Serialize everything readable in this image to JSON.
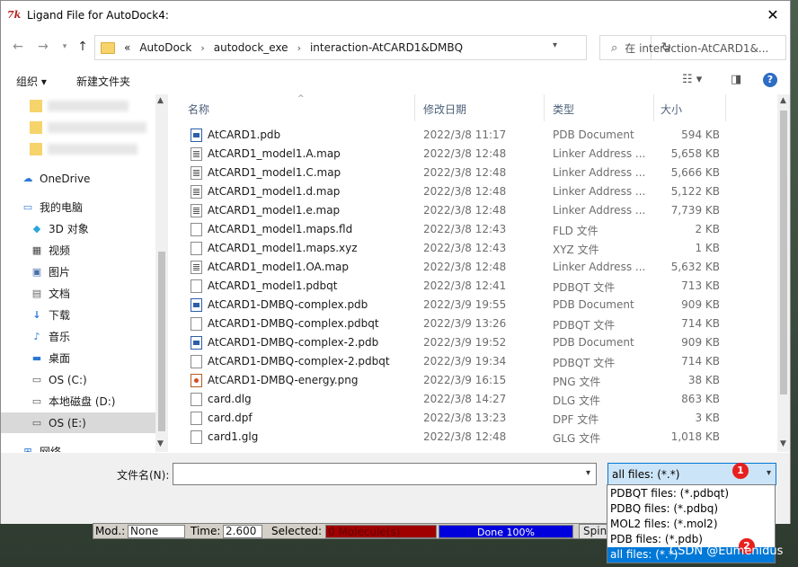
{
  "window": {
    "title": "Ligand File for AutoDock4:",
    "app_icon": "7k"
  },
  "addressbar": {
    "overflow": "«",
    "breadcrumbs": [
      "AutoDock",
      "autodock_exe",
      "interaction-AtCARD1&DMBQ"
    ],
    "search_placeholder": "在 interaction-AtCARD1&..."
  },
  "toolbar": {
    "organize": "组织 ▾",
    "new_folder": "新建文件夹"
  },
  "sidebar": {
    "items": [
      {
        "label": "OneDrive",
        "icon": "cloud-icon"
      },
      {
        "label": "我的电脑",
        "icon": "computer-icon"
      },
      {
        "label": "3D 对象",
        "icon": "3d-objects-icon"
      },
      {
        "label": "视频",
        "icon": "video-icon"
      },
      {
        "label": "图片",
        "icon": "pictures-icon"
      },
      {
        "label": "文档",
        "icon": "documents-icon"
      },
      {
        "label": "下载",
        "icon": "download-icon"
      },
      {
        "label": "音乐",
        "icon": "music-icon"
      },
      {
        "label": "桌面",
        "icon": "desktop-icon"
      },
      {
        "label": "OS (C:)",
        "icon": "drive-icon"
      },
      {
        "label": "本地磁盘 (D:)",
        "icon": "drive-icon"
      },
      {
        "label": "OS (E:)",
        "icon": "drive-icon"
      },
      {
        "label": "网络",
        "icon": "network-icon"
      }
    ]
  },
  "columns": {
    "name": "名称",
    "date": "修改日期",
    "type": "类型",
    "size": "大小"
  },
  "files": [
    {
      "name": "AtCARD1.pdb",
      "date": "2022/3/8 11:17",
      "type": "PDB Document",
      "size": "594 KB",
      "icon": "pdb"
    },
    {
      "name": "AtCARD1_model1.A.map",
      "date": "2022/3/8 12:48",
      "type": "Linker Address ...",
      "size": "5,658 KB",
      "icon": "map"
    },
    {
      "name": "AtCARD1_model1.C.map",
      "date": "2022/3/8 12:48",
      "type": "Linker Address ...",
      "size": "5,666 KB",
      "icon": "map"
    },
    {
      "name": "AtCARD1_model1.d.map",
      "date": "2022/3/8 12:48",
      "type": "Linker Address ...",
      "size": "5,122 KB",
      "icon": "map"
    },
    {
      "name": "AtCARD1_model1.e.map",
      "date": "2022/3/8 12:48",
      "type": "Linker Address ...",
      "size": "7,739 KB",
      "icon": "map"
    },
    {
      "name": "AtCARD1_model1.maps.fld",
      "date": "2022/3/8 12:43",
      "type": "FLD 文件",
      "size": "2 KB",
      "icon": "file"
    },
    {
      "name": "AtCARD1_model1.maps.xyz",
      "date": "2022/3/8 12:43",
      "type": "XYZ 文件",
      "size": "1 KB",
      "icon": "file"
    },
    {
      "name": "AtCARD1_model1.OA.map",
      "date": "2022/3/8 12:48",
      "type": "Linker Address ...",
      "size": "5,632 KB",
      "icon": "map"
    },
    {
      "name": "AtCARD1_model1.pdbqt",
      "date": "2022/3/8 12:41",
      "type": "PDBQT 文件",
      "size": "713 KB",
      "icon": "file"
    },
    {
      "name": "AtCARD1-DMBQ-complex.pdb",
      "date": "2022/3/9 19:55",
      "type": "PDB Document",
      "size": "909 KB",
      "icon": "pdb"
    },
    {
      "name": "AtCARD1-DMBQ-complex.pdbqt",
      "date": "2022/3/9 13:26",
      "type": "PDBQT 文件",
      "size": "714 KB",
      "icon": "file"
    },
    {
      "name": "AtCARD1-DMBQ-complex-2.pdb",
      "date": "2022/3/9 19:52",
      "type": "PDB Document",
      "size": "909 KB",
      "icon": "pdb"
    },
    {
      "name": "AtCARD1-DMBQ-complex-2.pdbqt",
      "date": "2022/3/9 19:34",
      "type": "PDBQT 文件",
      "size": "714 KB",
      "icon": "file"
    },
    {
      "name": "AtCARD1-DMBQ-energy.png",
      "date": "2022/3/9 16:15",
      "type": "PNG 文件",
      "size": "38 KB",
      "icon": "png"
    },
    {
      "name": "card.dlg",
      "date": "2022/3/8 14:27",
      "type": "DLG 文件",
      "size": "863 KB",
      "icon": "file"
    },
    {
      "name": "card.dpf",
      "date": "2022/3/8 13:23",
      "type": "DPF 文件",
      "size": "3 KB",
      "icon": "file"
    },
    {
      "name": "card1.glg",
      "date": "2022/3/8 12:48",
      "type": "GLG 文件",
      "size": "1,018 KB",
      "icon": "file"
    }
  ],
  "bottom": {
    "filename_label": "文件名(N):",
    "filename_value": "",
    "filetype_selected": "all files: (*.*)",
    "filetype_options": [
      "PDBQT files: (*.pdbqt)",
      "PDBQ files: (*.pdbq)",
      "MOL2 files: (*.mol2)",
      "PDB files: (*.pdb)",
      "all files: (*.*)"
    ],
    "badge1": "1",
    "badge2": "2"
  },
  "statusbar": {
    "mod_label": "Mod.:",
    "mod_value": "None",
    "time_label": "Time:",
    "time_value": "2.600",
    "selected_label": "Selected:",
    "selected_value": "0 Molecule(s)",
    "progress": "Done 100%",
    "spin": "Spin"
  },
  "watermark": "CSDN @Eumenidus"
}
